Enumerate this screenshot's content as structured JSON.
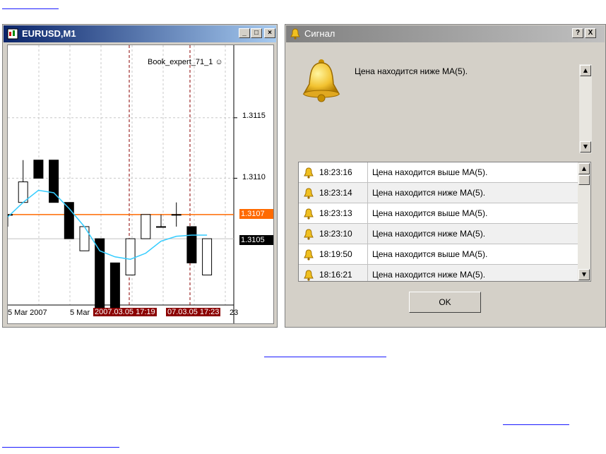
{
  "chart_window": {
    "title": "EURUSD,M1",
    "expert_label": "Book_expert_71_1 ☺",
    "price_labels": [
      "1.3115",
      "1.3110"
    ],
    "bid_price": "1.3107",
    "cursor_price": "1.3105",
    "time_labels": [
      "5 Mar 2007",
      "5 Mar",
      "2007.03.05 17:19",
      "07.03.05 17:23",
      "23"
    ],
    "colors": {
      "bid_line": "#ff6a00",
      "ma_line": "#33ccff",
      "vline": "#8b0000",
      "time_highlight": "#8b0000"
    }
  },
  "chart_data": {
    "type": "candlestick",
    "ylim": [
      1.3098,
      1.3121
    ],
    "candles": [
      {
        "o": 1.3107,
        "h": 1.3107,
        "l": 1.3106,
        "c": 1.3107
      },
      {
        "o": 1.3108,
        "h": 1.31115,
        "l": 1.3108,
        "c": 1.31097
      },
      {
        "o": 1.31115,
        "h": 1.31115,
        "l": 1.311,
        "c": 1.311
      },
      {
        "o": 1.31115,
        "h": 1.31115,
        "l": 1.3108,
        "c": 1.3108
      },
      {
        "o": 1.3108,
        "h": 1.3108,
        "l": 1.3105,
        "c": 1.3105
      },
      {
        "o": 1.3104,
        "h": 1.3106,
        "l": 1.3104,
        "c": 1.3106
      },
      {
        "o": 1.3105,
        "h": 1.3105,
        "l": 1.3099,
        "c": 1.3099
      },
      {
        "o": 1.3103,
        "h": 1.3103,
        "l": 1.3099,
        "c": 1.3099
      },
      {
        "o": 1.3102,
        "h": 1.3105,
        "l": 1.3102,
        "c": 1.3105
      },
      {
        "o": 1.3105,
        "h": 1.3107,
        "l": 1.3105,
        "c": 1.3107
      },
      {
        "o": 1.3106,
        "h": 1.3107,
        "l": 1.3106,
        "c": 1.3106
      },
      {
        "o": 1.3107,
        "h": 1.3108,
        "l": 1.3106,
        "c": 1.3107
      },
      {
        "o": 1.3106,
        "h": 1.3106,
        "l": 1.3103,
        "c": 1.3103
      },
      {
        "o": 1.3102,
        "h": 1.3105,
        "l": 1.3102,
        "c": 1.3105
      }
    ],
    "ma": [
      1.31068,
      1.3108,
      1.3109,
      1.31088,
      1.31075,
      1.3106,
      1.3104,
      1.31035,
      1.31033,
      1.31038,
      1.31048,
      1.31052,
      1.31053,
      1.31053
    ]
  },
  "signal_window": {
    "title": "Сигнал",
    "help_button": "?",
    "close_button": "X",
    "alert_message": "Цена находится ниже MA(5).",
    "log": [
      {
        "time": "18:23:16",
        "message": "Цена находится выше MA(5)."
      },
      {
        "time": "18:23:14",
        "message": "Цена находится ниже MA(5)."
      },
      {
        "time": "18:23:13",
        "message": "Цена находится выше MA(5)."
      },
      {
        "time": "18:23:10",
        "message": "Цена находится ниже MA(5)."
      },
      {
        "time": "18:19:50",
        "message": "Цена находится выше MA(5)."
      },
      {
        "time": "18:16:21",
        "message": "Цена находится ниже MA(5)."
      }
    ],
    "ok_label": "OK"
  }
}
